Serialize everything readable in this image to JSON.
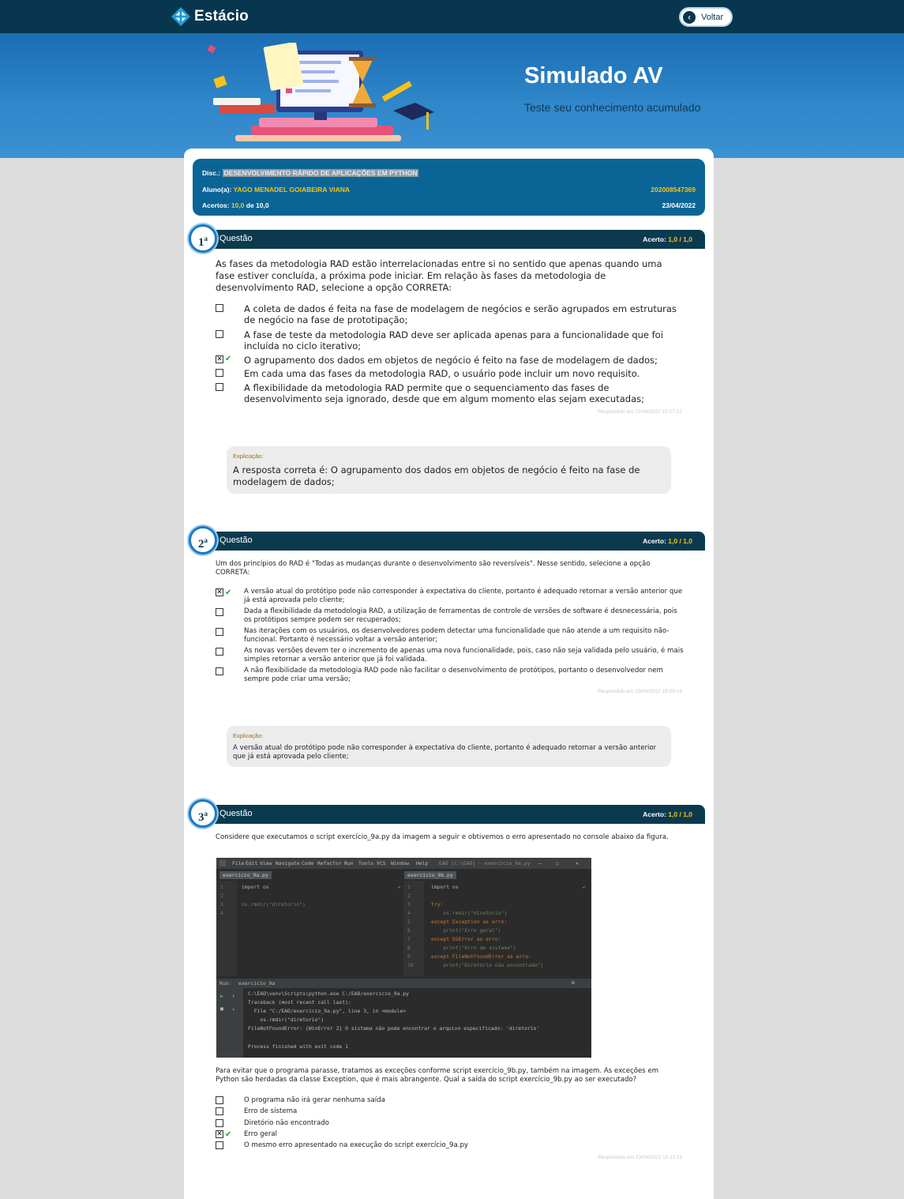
{
  "header": {
    "brand": "Estácio",
    "back_label": "Voltar"
  },
  "banner": {
    "title": "Simulado AV",
    "subtitle": "Teste seu conhecimento acumulado"
  },
  "info": {
    "disc_label": "Disc.:",
    "disc_value": "DESENVOLVIMENTO RÁPIDO DE APLICAÇÕES EM PYTHON",
    "student_label": "Aluno(a):",
    "student_name": "YAGO MENADEL GOIABEIRA VIANA",
    "student_id": "202008547369",
    "score_label": "Acertos:",
    "score_value": "10,0",
    "score_of": "de 10,0",
    "date": "23/04/2022"
  },
  "questions": [
    {
      "number": "1",
      "title": "Questão",
      "score_label": "Acerto:",
      "score": "1,0 / 1,0",
      "text": " As fases da metodologia RAD estão interrelacionadas entre si no sentido que apenas quando uma fase estiver concluída, a próxima pode iniciar. Em relação às fases da metodologia de desenvolvimento RAD, selecione a opção CORRETA:",
      "options": [
        "A coleta de dados é feita na fase de modelagem de negócios e serão agrupados em estruturas de negócio na fase de prototipação;",
        "A fase de teste da metodologia RAD deve ser aplicada apenas para a funcionalidade que foi incluída no ciclo iterativo;",
        "O agrupamento dos dados em objetos de negócio é feito na fase de modelagem de dados;",
        "Em cada uma das fases da metodologia RAD, o usuário pode incluir um novo requisito.",
        "A flexibilidade da metodologia RAD permite que o sequenciamento das fases de desenvolvimento seja ignorado, desde que em algum momento elas sejam executadas;"
      ],
      "answered": "Respondido em 23/04/2022 15:07:12",
      "explanation_title": "Explicação:",
      "explanation": "A resposta correta é: O agrupamento dos dados em objetos de negócio é feito na fase de modelagem de dados;"
    },
    {
      "number": "2",
      "title": "Questão",
      "score_label": "Acerto:",
      "score": "1,0 / 1,0",
      "text": "Um dos princípios do RAD é \"Todas as mudanças durante o desenvolvimento são reversíveis\". Nesse sentido, selecione a opção CORRETA:",
      "options": [
        "A versão atual do protótipo pode não corresponder à expectativa do cliente, portanto é adequado retornar a versão anterior que já está aprovada pelo cliente;",
        "Dada a flexibilidade da metodologia RAD, a utilização de ferramentas de controle de versões de software é desnecessária, pois os protótipos sempre podem ser recuperados;",
        "Nas iterações com os usuários, os desenvolvedores podem detectar uma funcionalidade que não atende a um requisito não-funcional. Portanto é necessário voltar a versão anterior;",
        "As novas versões devem ter o incremento de apenas uma nova funcionalidade, pois, caso não seja validada pelo usuário, é mais simples retornar a versão anterior que já foi validada.",
        "A não flexibilidade da metodologia RAD pode não facilitar o desenvolvimento de protótipos, portanto o desenvolvedor nem sempre pode criar uma versão;"
      ],
      "answered": "Respondido em 23/04/2022 15:09:16",
      "explanation_title": "Explicação:",
      "explanation": "A versão atual do protótipo pode não corresponder à expectativa do cliente, portanto é adequado retornar a versão anterior que já está aprovada pelo cliente;"
    },
    {
      "number": "3",
      "title": "Questão",
      "score_label": "Acerto:",
      "score": "1,0 / 1,0",
      "text": "Considere que executamos o script exercício_9a.py da imagem a seguir e obtivemos o erro apresentado no console abaixo da figura.",
      "text2": "Para evitar que o programa parasse, tratamos as exceções conforme script exercício_9b.py, também na imagem. As exceções em Python são herdadas da classe Exception, que é mais abrangente. Qual a saída do script exercício_9b.py ao ser executado?",
      "options": [
        "O programa não irá gerar nenhuma saída",
        "Erro de sistema",
        "Diretório não encontrado",
        "Erro geral",
        "O mesmo erro apresentado na execução do script exercício_9a.py"
      ],
      "answered": "Respondido em 23/04/2022 15:11:21"
    }
  ],
  "ide": {
    "menu": [
      "File",
      "Edit",
      "View",
      "Navigate",
      "Code",
      "Refactor",
      "Run",
      "Tools",
      "VCS",
      "Window",
      "Help"
    ],
    "window_title": "EAD [C:\\EAD] - exercicio_9a.py",
    "tab_left": "exercicio_9a.py",
    "tab_right": "exercicio_9b.py",
    "run_tab": "exercicio_9a",
    "run_label": "Run:",
    "left_code": [
      "import os",
      "",
      "os.rmdir(\"diretorio\")",
      ""
    ],
    "right_code": [
      "import os",
      "",
      "try:",
      "    os.rmdir(\"diretorio\")",
      "except Exception as erro:",
      "    print(\"Erro geral\")",
      "except OSError as erro:",
      "    print(\"Erro de sistema\")",
      "except FileNotFoundError as erro:",
      "    print(\"Diretório não encontrado\")"
    ],
    "console": [
      "C:\\EAD\\venv\\Scripts\\python.exe C:/EAD/exercicio_9a.py",
      "Traceback (most recent call last):",
      "  File \"C:/EAD/exercicio_9a.py\", line 3, in <module>",
      "    os.rmdir(\"diretorio\")",
      "FileNotFoundError: [WinError 2] O sistema não pode encontrar o arquivo especificado: 'diretorio'",
      "",
      "Process finished with exit code 1"
    ]
  },
  "answers": {
    "q1_selected_index": 2,
    "q2_selected_index": 0,
    "q3_selected_index": 3
  },
  "colors": {
    "topbar": "#08364f",
    "info_box": "#0a6596",
    "question_header": "#0b3a4f",
    "highlight": "#f7c21a",
    "correct_check": "#25a138"
  }
}
